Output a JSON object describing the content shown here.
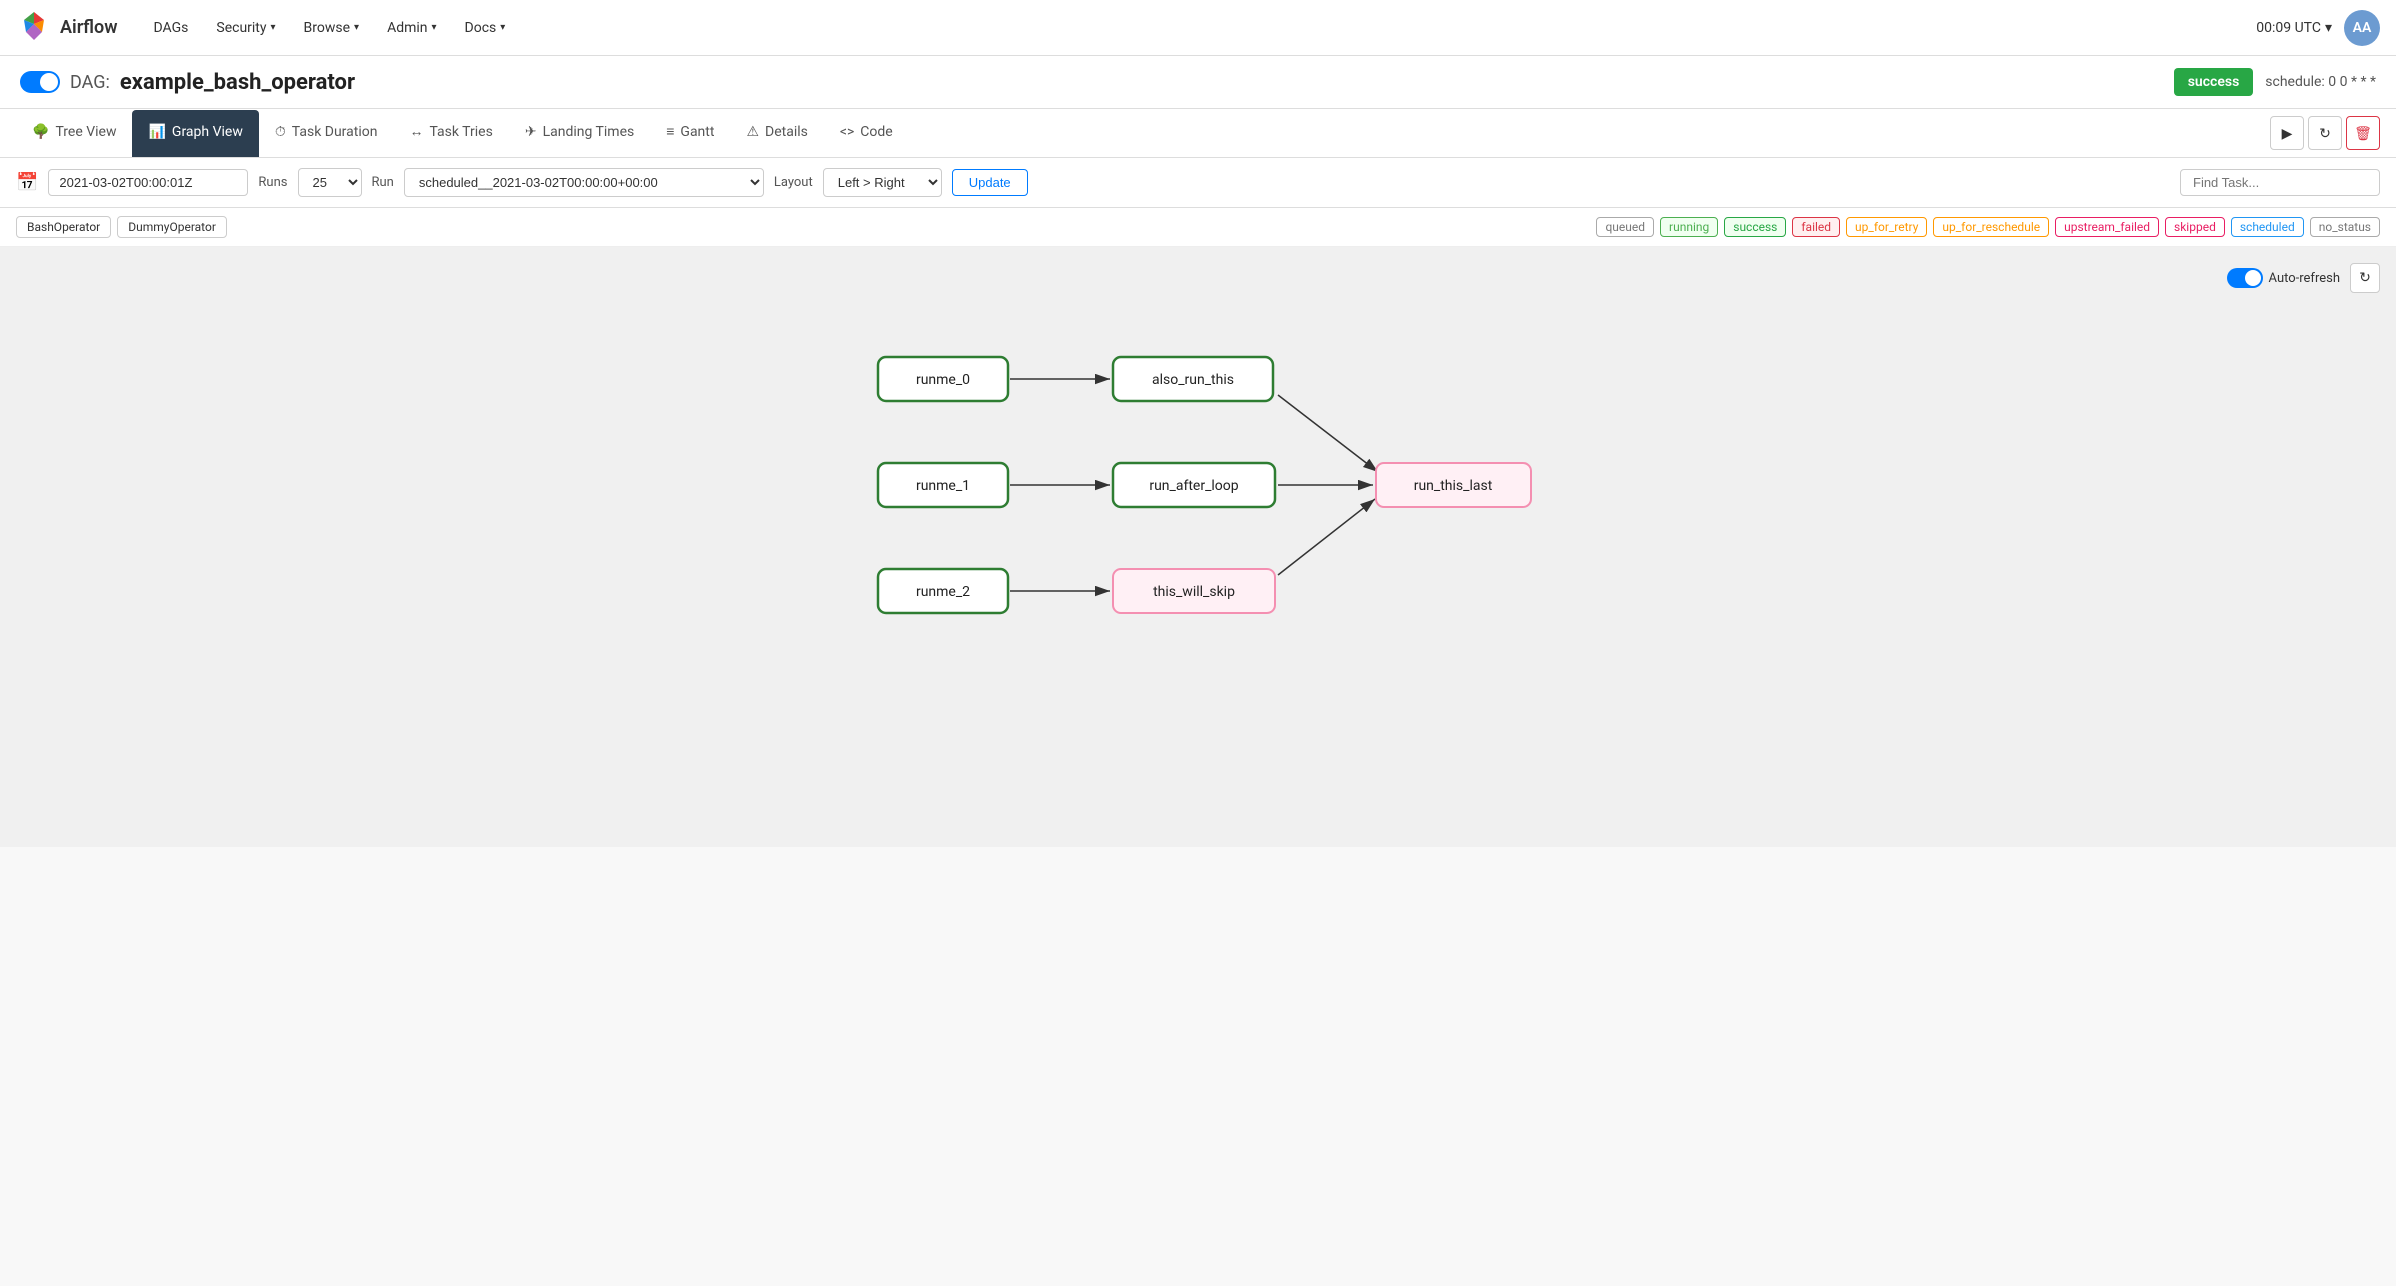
{
  "navbar": {
    "brand": "Airflow",
    "time": "00:09 UTC",
    "avatar": "AA",
    "nav_items": [
      {
        "label": "DAGs",
        "has_caret": false
      },
      {
        "label": "Security",
        "has_caret": true
      },
      {
        "label": "Browse",
        "has_caret": true
      },
      {
        "label": "Admin",
        "has_caret": true
      },
      {
        "label": "Docs",
        "has_caret": true
      }
    ]
  },
  "page_header": {
    "dag_prefix": "DAG:",
    "dag_name": "example_bash_operator",
    "status_badge": "success",
    "schedule_text": "schedule: 0 0 * * *"
  },
  "tabs": [
    {
      "label": "Tree View",
      "icon": "🌳",
      "active": false
    },
    {
      "label": "Graph View",
      "icon": "📊",
      "active": true
    },
    {
      "label": "Task Duration",
      "icon": "⏱",
      "active": false
    },
    {
      "label": "Task Tries",
      "icon": "↔",
      "active": false
    },
    {
      "label": "Landing Times",
      "icon": "✈",
      "active": false
    },
    {
      "label": "Gantt",
      "icon": "≡",
      "active": false
    },
    {
      "label": "Details",
      "icon": "⚠",
      "active": false
    },
    {
      "label": "Code",
      "icon": "<>",
      "active": false
    }
  ],
  "controls": {
    "date_value": "2021-03-02T00:00:01Z",
    "runs_label": "Runs",
    "runs_value": "25",
    "run_label": "Run",
    "run_value": "scheduled__2021-03-02T00:00:00+00:00",
    "layout_label": "Layout",
    "layout_value": "Left > Right",
    "update_label": "Update",
    "find_placeholder": "Find Task..."
  },
  "operators": [
    {
      "label": "BashOperator"
    },
    {
      "label": "DummyOperator"
    }
  ],
  "status_legend": [
    {
      "key": "queued",
      "label": "queued"
    },
    {
      "key": "running",
      "label": "running"
    },
    {
      "key": "success",
      "label": "success"
    },
    {
      "key": "failed",
      "label": "failed"
    },
    {
      "key": "up_for_retry",
      "label": "up_for_retry"
    },
    {
      "key": "up_for_reschedule",
      "label": "up_for_reschedule"
    },
    {
      "key": "upstream_failed",
      "label": "upstream_failed"
    },
    {
      "key": "skipped",
      "label": "skipped"
    },
    {
      "key": "scheduled",
      "label": "scheduled"
    },
    {
      "key": "no_status",
      "label": "no_status"
    }
  ],
  "graph": {
    "auto_refresh_label": "Auto-refresh",
    "nodes": [
      {
        "id": "runme_0",
        "label": "runme_0",
        "style": "green"
      },
      {
        "id": "runme_1",
        "label": "runme_1",
        "style": "green"
      },
      {
        "id": "runme_2",
        "label": "runme_2",
        "style": "green"
      },
      {
        "id": "also_run_this",
        "label": "also_run_this",
        "style": "green"
      },
      {
        "id": "run_after_loop",
        "label": "run_after_loop",
        "style": "green"
      },
      {
        "id": "this_will_skip",
        "label": "this_will_skip",
        "style": "pink"
      },
      {
        "id": "run_this_last",
        "label": "run_this_last",
        "style": "pink"
      }
    ]
  }
}
